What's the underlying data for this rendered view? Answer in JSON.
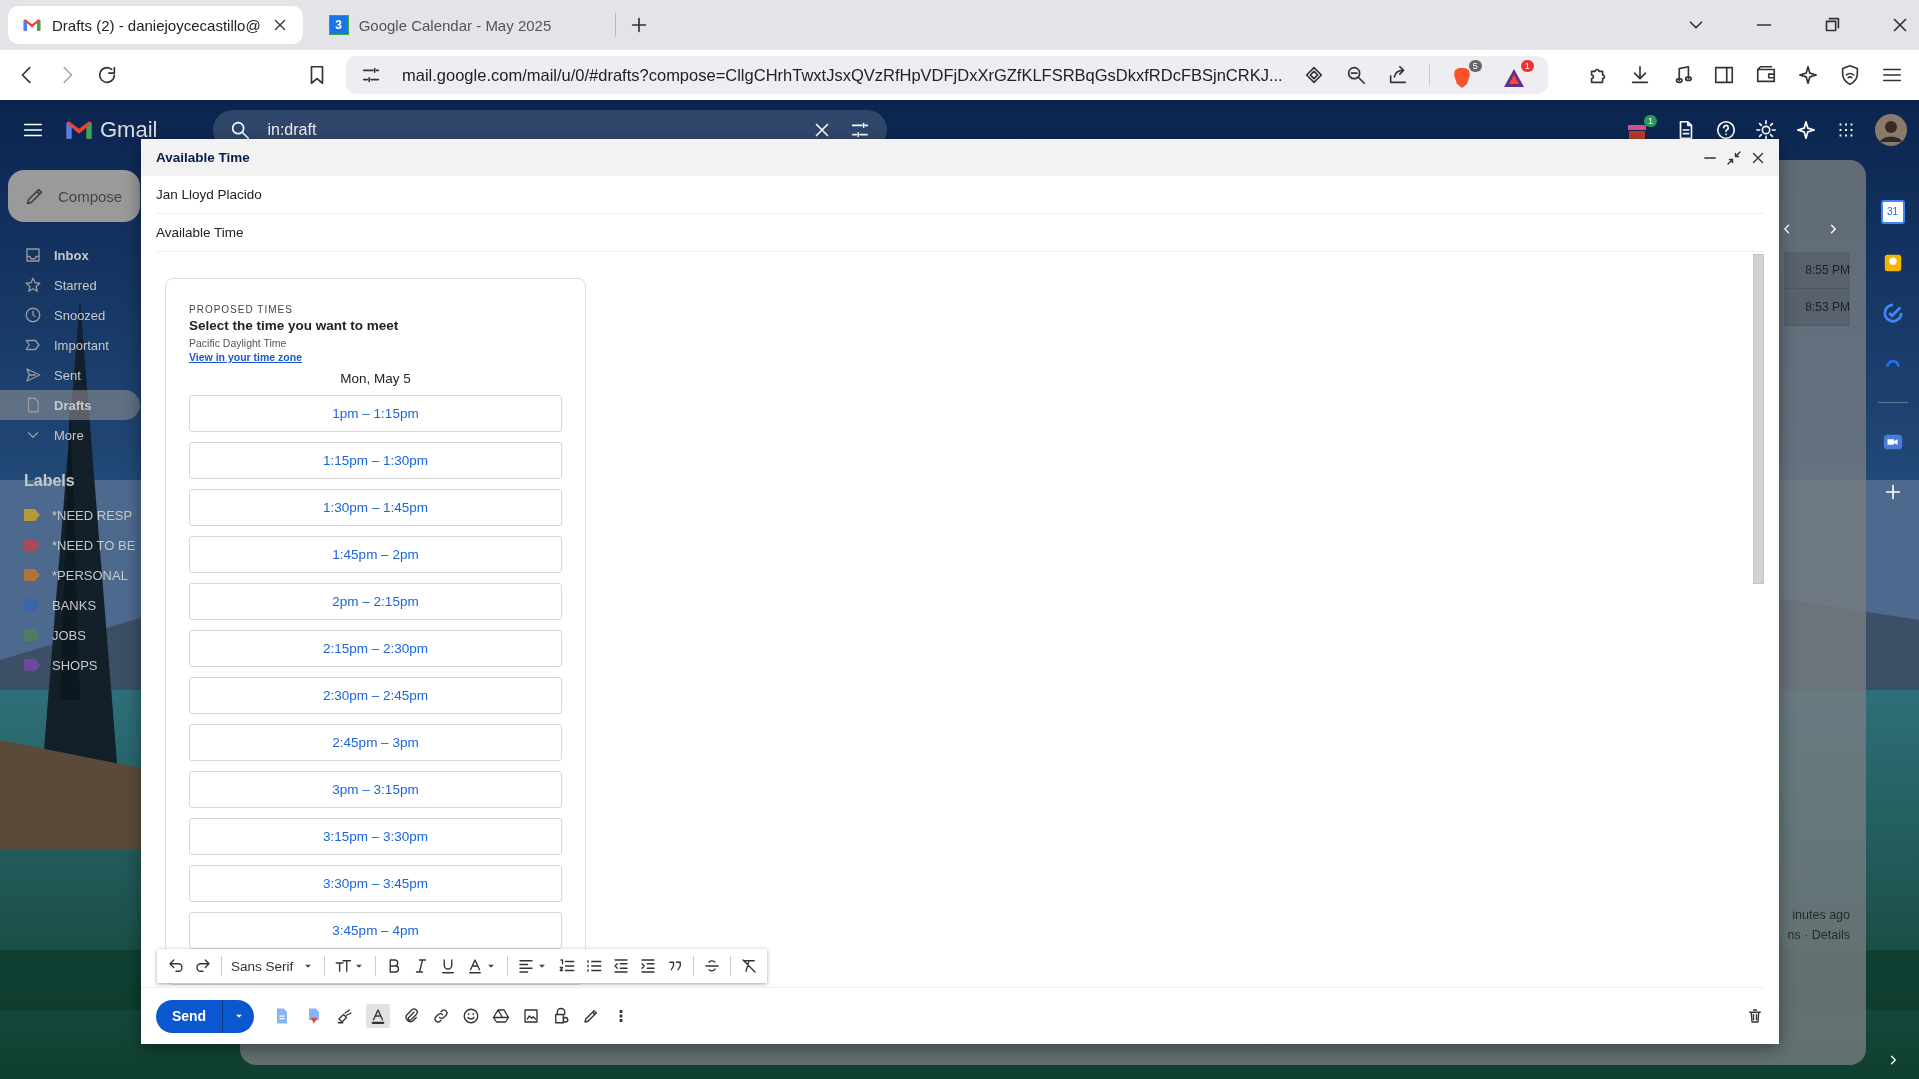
{
  "browser": {
    "tabs": [
      {
        "kind": "mail",
        "title": "Drafts (2) - daniejoycecastillo@",
        "selected": true
      },
      {
        "kind": "calendar",
        "favicon_text": "3",
        "title": "Google Calendar - May 2025",
        "selected": false
      }
    ],
    "url": "mail.google.com/mail/u/0/#drafts?compose=CllgCHrhTwxtJsxQVzRfHpVDFjDxXrGZfKLFSRBqGsDkxfRDcFBSjnCRKJ...",
    "shields_badge": "5",
    "rewards_badge": "1"
  },
  "gmail": {
    "logo": "Gmail",
    "search": {
      "value": "in:draft"
    },
    "addon_badge": "1",
    "sidebar": {
      "compose": "Compose",
      "items": [
        {
          "label": "Inbox",
          "unread": true,
          "selected": false
        },
        {
          "label": "Starred",
          "unread": false,
          "selected": false
        },
        {
          "label": "Snoozed",
          "unread": false,
          "selected": false
        },
        {
          "label": "Important",
          "unread": false,
          "selected": false
        },
        {
          "label": "Sent",
          "unread": false,
          "selected": false
        },
        {
          "label": "Drafts",
          "unread": true,
          "selected": true
        },
        {
          "label": "More",
          "unread": false,
          "selected": false
        }
      ],
      "labels_heading": "Labels",
      "labels": [
        {
          "name": "*NEED RESP",
          "color": "#b59a3c"
        },
        {
          "name": "*NEED TO BE",
          "color": "#a84a5a"
        },
        {
          "name": "*PERSONAL",
          "color": "#b07434"
        },
        {
          "name": "BANKS",
          "color": "#3d64a8"
        },
        {
          "name": "JOBS",
          "color": "#4f7d5f"
        },
        {
          "name": "SHOPS",
          "color": "#6a4a9a"
        }
      ]
    },
    "list": {
      "times": [
        "8:55 PM",
        "8:53 PM"
      ],
      "footer": [
        "inutes ago",
        "ns · Details"
      ]
    },
    "rail": {
      "calendar_text": "31"
    }
  },
  "compose": {
    "title": "Available Time",
    "to": "Jan Lloyd Placido",
    "subject": "Available Time",
    "card": {
      "eyebrow": "PROPOSED TIMES",
      "heading": "Select the time you want to meet",
      "timezone": "Pacific Daylight Time",
      "link": "View in your time zone",
      "date": "Mon, May 5",
      "slots": [
        "1pm – 1:15pm",
        "1:15pm – 1:30pm",
        "1:30pm – 1:45pm",
        "1:45pm – 2pm",
        "2pm – 2:15pm",
        "2:15pm – 2:30pm",
        "2:30pm – 2:45pm",
        "2:45pm – 3pm",
        "3pm – 3:15pm",
        "3:15pm – 3:30pm",
        "3:30pm – 3:45pm",
        "3:45pm – 4pm"
      ]
    },
    "font": "Sans Serif",
    "send": "Send",
    "formatting_on": true
  }
}
